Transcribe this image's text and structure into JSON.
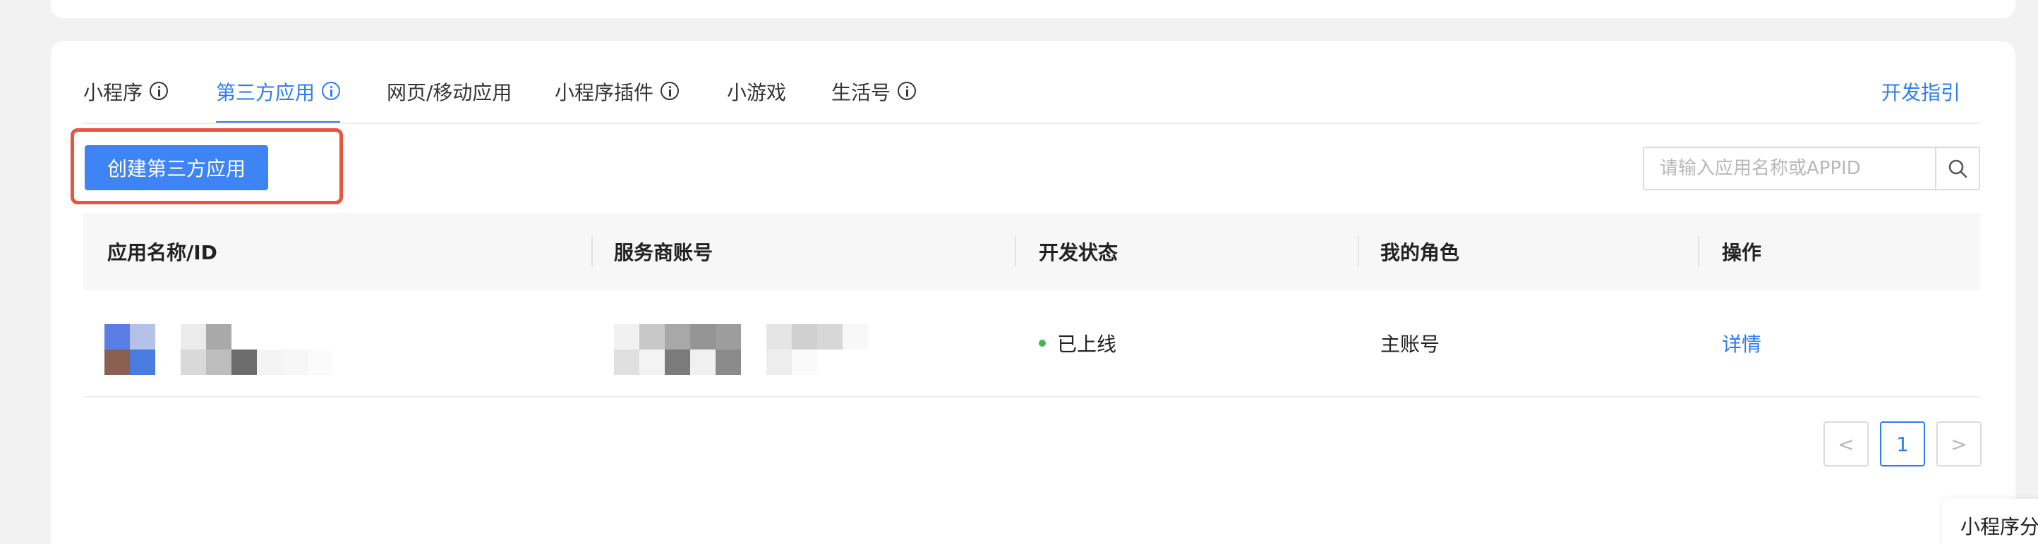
{
  "tabs": [
    {
      "label": "小程序",
      "has_info": true,
      "active": false
    },
    {
      "label": "第三方应用",
      "has_info": true,
      "active": true
    },
    {
      "label": "网页/移动应用",
      "has_info": false,
      "active": false
    },
    {
      "label": "小程序插件",
      "has_info": true,
      "active": false
    },
    {
      "label": "小游戏",
      "has_info": false,
      "active": false
    },
    {
      "label": "生活号",
      "has_info": true,
      "active": false
    }
  ],
  "guide_link": "开发指引",
  "create_button": "创建第三方应用",
  "search": {
    "placeholder": "请输入应用名称或APPID",
    "icon": "search-icon"
  },
  "table": {
    "headers": [
      "应用名称/ID",
      "服务商账号",
      "开发状态",
      "我的角色",
      "操作"
    ],
    "rows": [
      {
        "status": "已上线",
        "role": "主账号",
        "action": "详情"
      }
    ]
  },
  "pagination": {
    "prev": "<",
    "current": "1",
    "next": ">"
  },
  "floating_tag": "小程序分",
  "colors": {
    "accent": "#2d7cf3",
    "highlight": "#e9533f",
    "status_online": "#3fb950"
  }
}
